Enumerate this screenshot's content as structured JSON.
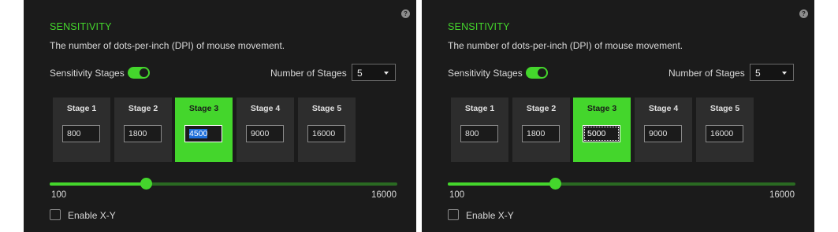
{
  "panels": [
    {
      "help": "?",
      "title": "SENSITIVITY",
      "description": "The number of dots-per-inch (DPI) of mouse movement.",
      "sensitivity_stages_label": "Sensitivity Stages",
      "sensitivity_stages_enabled": true,
      "number_of_stages_label": "Number of Stages",
      "number_of_stages_value": "5",
      "active_stage": 3,
      "stages": [
        {
          "label": "Stage 1",
          "value": "800"
        },
        {
          "label": "Stage 2",
          "value": "1800"
        },
        {
          "label": "Stage 3",
          "value": "4500"
        },
        {
          "label": "Stage 4",
          "value": "9000"
        },
        {
          "label": "Stage 5",
          "value": "16000"
        }
      ],
      "slider": {
        "min_label": "100",
        "max_label": "16000",
        "min": 100,
        "max": 16000,
        "value": 4500
      },
      "enable_xy_label": "Enable X-Y",
      "enable_xy_checked": false
    },
    {
      "help": "?",
      "title": "SENSITIVITY",
      "description": "The number of dots-per-inch (DPI) of mouse movement.",
      "sensitivity_stages_label": "Sensitivity Stages",
      "sensitivity_stages_enabled": true,
      "number_of_stages_label": "Number of Stages",
      "number_of_stages_value": "5",
      "active_stage": 3,
      "stages": [
        {
          "label": "Stage 1",
          "value": "800"
        },
        {
          "label": "Stage 2",
          "value": "1800"
        },
        {
          "label": "Stage 3",
          "value": "5000"
        },
        {
          "label": "Stage 4",
          "value": "9000"
        },
        {
          "label": "Stage 5",
          "value": "16000"
        }
      ],
      "slider": {
        "min_label": "100",
        "max_label": "16000",
        "min": 100,
        "max": 16000,
        "value": 5000
      },
      "enable_xy_label": "Enable X-Y",
      "enable_xy_checked": false
    }
  ],
  "colors": {
    "accent": "#44d62c",
    "panel_bg": "#1b1b1b",
    "stage_bg": "#2d2d2d"
  }
}
